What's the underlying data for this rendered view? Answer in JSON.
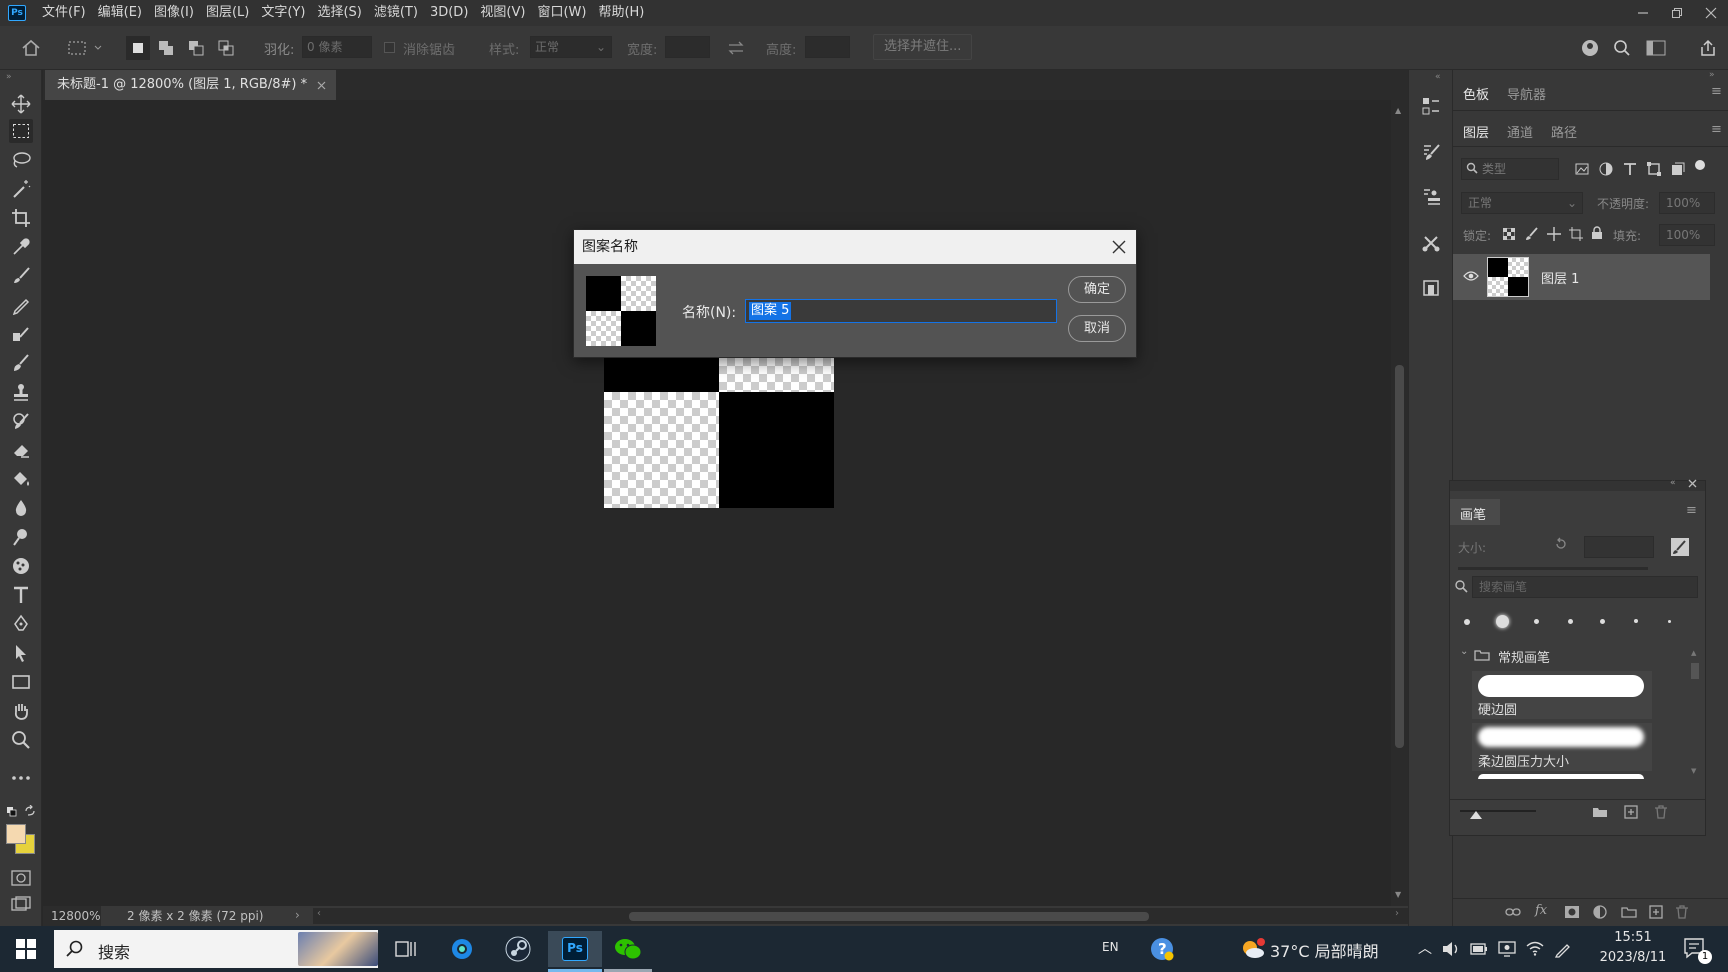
{
  "menubar": {
    "logo": "Ps",
    "items": [
      "文件(F)",
      "编辑(E)",
      "图像(I)",
      "图层(L)",
      "文字(Y)",
      "选择(S)",
      "滤镜(T)",
      "3D(D)",
      "视图(V)",
      "窗口(W)",
      "帮助(H)"
    ]
  },
  "options": {
    "feather_label": "羽化:",
    "feather_value": "0 像素",
    "antialias_label": "消除锯齿",
    "style_label": "样式:",
    "style_value": "正常",
    "width_label": "宽度:",
    "height_label": "高度:",
    "select_mask_button": "选择并遮住..."
  },
  "document": {
    "tab_title": "未标题-1 @ 12800% (图层 1, RGB/8#) *",
    "zoom": "12800%",
    "info": "2 像素 x 2 像素 (72 ppi)"
  },
  "dialog": {
    "title": "图案名称",
    "name_label": "名称(N):",
    "name_value": "图案 5",
    "ok_button": "确定",
    "cancel_button": "取消"
  },
  "panels": {
    "top_tabs": [
      "色板",
      "导航器"
    ],
    "layer_tabs": [
      "图层",
      "通道",
      "路径"
    ],
    "filter_placeholder": "类型",
    "blend_mode": "正常",
    "opacity_label": "不透明度:",
    "opacity_value": "100%",
    "lock_label": "锁定:",
    "fill_label": "填充:",
    "fill_value": "100%",
    "layer_name": "图层 1"
  },
  "brush_panel": {
    "title": "画笔",
    "size_label": "大小:",
    "search_placeholder": "搜索画笔",
    "group_name": "常规画笔",
    "brushes": [
      "硬边圆",
      "柔边圆压力大小"
    ]
  },
  "taskbar": {
    "search_label": "搜索",
    "ime": "EN",
    "weather": "37°C  局部晴朗",
    "time": "15:51",
    "date": "2023/8/11",
    "notification_count": "1",
    "ps_label": "Ps"
  },
  "colors": {
    "accent_selection": "#1473e6",
    "foreground": "#f5d9b0",
    "background": "#e6d23c"
  }
}
